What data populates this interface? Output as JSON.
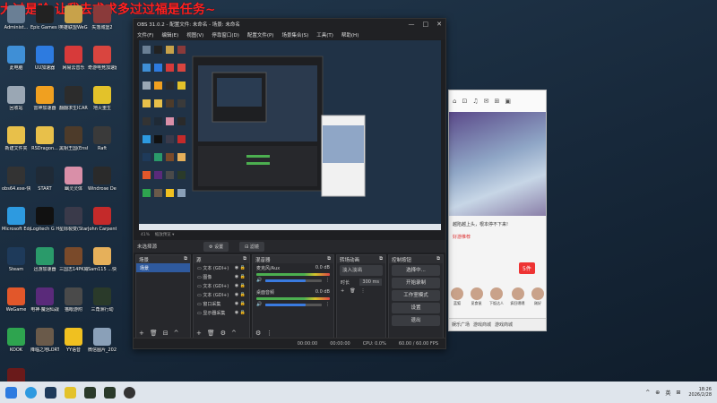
{
  "banner": "大过是哈 让我去求求多过过福是任务~",
  "desktop": {
    "icons": [
      {
        "label": "Administ...",
        "color": "#6a7f95"
      },
      {
        "label": "Epic Games Launcher",
        "color": "#222222"
      },
      {
        "label": "英雄联盟WeGame版",
        "color": "#c8a24a"
      },
      {
        "label": "失落城堡2",
        "color": "#8a3a3a"
      },
      {
        "label": "此电脑",
        "color": "#3f8fd6"
      },
      {
        "label": "UU加速器",
        "color": "#2d7be0"
      },
      {
        "label": "网易云音乐",
        "color": "#d73a3a"
      },
      {
        "label": "奇游电竞加速器",
        "color": "#d9453f"
      },
      {
        "label": "回收站",
        "color": "#9aa7b4"
      },
      {
        "label": "雷神加速器",
        "color": "#f0a020"
      },
      {
        "label": "翻翻求生ICARUS",
        "color": "#2c2c2c"
      },
      {
        "label": "地火重生",
        "color": "#e3c22a"
      },
      {
        "label": "新建文件夹",
        "color": "#e8c04a"
      },
      {
        "label": "RSDragon...",
        "color": "#e8c04a"
      },
      {
        "label": "黑钥王国(Enshrou...",
        "color": "#4d3b2a"
      },
      {
        "label": "Raft",
        "color": "#3a3a3a"
      },
      {
        "label": "obs64.exe-快捷方式",
        "color": "#333333"
      },
      {
        "label": "START",
        "color": "#1f2a36"
      },
      {
        "label": "幽灵灵体",
        "color": "#d98fa8"
      },
      {
        "label": "Windrose Demo",
        "color": "#2a2a2a"
      },
      {
        "label": "Microsoft Edge",
        "color": "#2d9ae0"
      },
      {
        "label": "Logitech G HUB",
        "color": "#111111"
      },
      {
        "label": "星际裂变(StarRupt...",
        "color": "#3a3a4a"
      },
      {
        "label": "John Carpenter...",
        "color": "#c42a2a"
      },
      {
        "label": "Steam",
        "color": "#1e3a5a"
      },
      {
        "label": "迅游加速器",
        "color": "#2a9a6a"
      },
      {
        "label": "三国志14PK威力加强版",
        "color": "#7a4a2a"
      },
      {
        "label": "Sam115 ...快捷方式",
        "color": "#e6b05a"
      },
      {
        "label": "WeGame",
        "color": "#e2572a"
      },
      {
        "label": "电神·魔泪仙战",
        "color": "#5a2a7a"
      },
      {
        "label": "猫眼游附",
        "color": "#4a4a4a"
      },
      {
        "label": "三角洲行动",
        "color": "#2a3a2a"
      },
      {
        "label": "KOOK",
        "color": "#2ea44f"
      },
      {
        "label": "降临之地LORT",
        "color": "#6a5a4a"
      },
      {
        "label": "YY语音",
        "color": "#f0c020"
      },
      {
        "label": "微信图片_2025082...",
        "color": "#8aa0b8"
      },
      {
        "label": "Vampires Bloodlo...",
        "color": "#6a1a1a"
      }
    ]
  },
  "side_panel": {
    "nav": [
      "⌂",
      "⊡",
      "♫",
      "✉",
      "⊞",
      "▣"
    ],
    "caption1": "越陷越上头，根本停不下来!",
    "caption2": "好游推荐",
    "badge": "5件",
    "users": [
      "蓝狐",
      "觅食鼠",
      "下饭达人",
      "疯狂嗯嗯",
      "刚好"
    ],
    "bottom": [
      "娱乐广场",
      "游戏商城",
      "游戏商城"
    ]
  },
  "obs": {
    "title": "OBS 31.0.2 - 配置文件: 未命名 - 场景: 未命名",
    "menu": [
      "文件(F)",
      "编辑(E)",
      "视图(V)",
      "停靠窗口(D)",
      "配置文件(P)",
      "场景集合(S)",
      "工具(T)",
      "帮助(H)"
    ],
    "preview_zoom": "41%",
    "preview_hint": "缩放预览 ▾",
    "source_bar": {
      "no_source": "未选择源",
      "props": "⚙ 设置",
      "filters": "⊟ 滤镜"
    },
    "scenes": {
      "title": "场景",
      "items": [
        "场景"
      ]
    },
    "sources": {
      "title": "源",
      "items": [
        "文本 (GDI+)",
        "图像",
        "文本 (GDI+)",
        "文本 (GDI+)",
        "窗口采集",
        "显示器采集"
      ]
    },
    "mixer": {
      "title": "混音器",
      "ch1": "麦克风/Aux",
      "ch1_db": "0.0 dB",
      "ch1_level": 0.72,
      "ch2": "桌面音频",
      "ch2_db": "0.0 dB",
      "ch2_level": 0.72
    },
    "transitions": {
      "title": "转场动画",
      "type": "淡入淡出",
      "duration_label": "时长",
      "duration": "300 ms"
    },
    "controls": {
      "title": "控制按钮",
      "buttons": [
        "选择中...",
        "开始录制",
        "工作室模式",
        "设置",
        "退出"
      ]
    },
    "status": {
      "rec": "00:00:00",
      "stream": "00:00:00",
      "cpu": "CPU: 0.0%",
      "fps": "60.00 / 60.00 FPS"
    }
  },
  "taskbar": {
    "tray": [
      "^",
      "⊕",
      "英",
      "⊞"
    ],
    "time": "18:26",
    "date": "2026/2/28"
  }
}
